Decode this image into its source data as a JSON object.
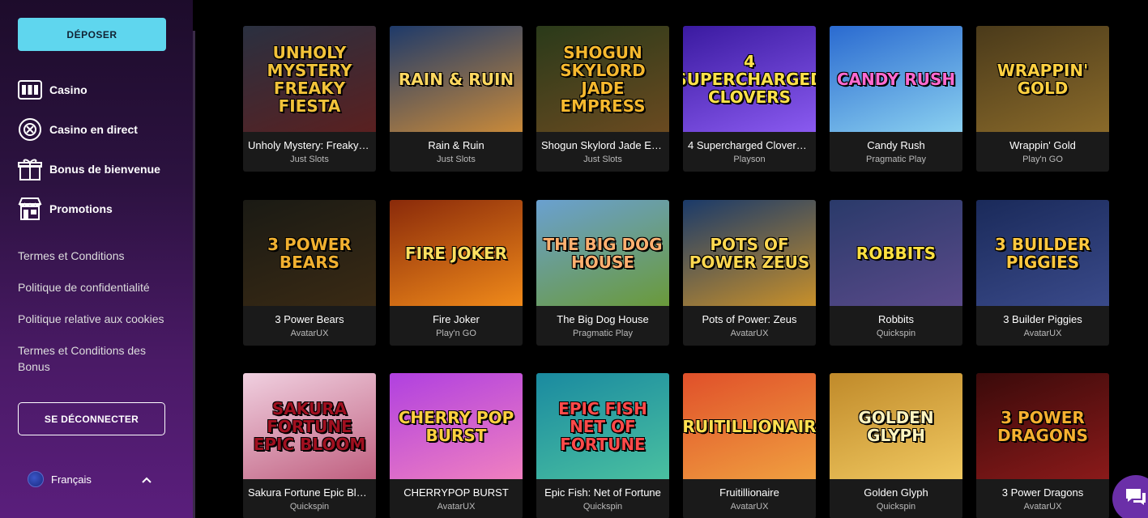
{
  "sidebar": {
    "deposit_label": "DÉPOSER",
    "nav": [
      {
        "label": "Casino",
        "icon": "slot-machine-icon"
      },
      {
        "label": "Casino en direct",
        "icon": "chip-icon"
      },
      {
        "label": "Bonus de bienvenue",
        "icon": "gift-icon"
      },
      {
        "label": "Promotions",
        "icon": "shop-icon"
      }
    ],
    "links": [
      "Termes et Conditions",
      "Politique de confidentialité",
      "Politique relative aux cookies",
      "Termes et Conditions des Bonus"
    ],
    "logout_label": "SE DÉCONNECTER",
    "language": "Français"
  },
  "colors": {
    "accent": "#5fd6ee",
    "sidebar_top": "#1d0c2b",
    "sidebar_bottom": "#5a1e7c",
    "chat": "#6b2fa8"
  },
  "games": [
    {
      "name": "Unholy Mystery: Freaky …",
      "provider": "Just Slots",
      "art": "UNHOLY MYSTERY FREAKY FIESTA",
      "bg": [
        "#2a3040",
        "#5a2020"
      ],
      "fg": "#f2c23a"
    },
    {
      "name": "Rain & Ruin",
      "provider": "Just Slots",
      "art": "RAIN & RUIN",
      "bg": [
        "#1e3a6a",
        "#c98a3a"
      ],
      "fg": "#ffd860"
    },
    {
      "name": "Shogun Skylord Jade Em…",
      "provider": "Just Slots",
      "art": "SHOGUN SKYLORD JADE EMPRESS",
      "bg": [
        "#2a3a1a",
        "#6a4a20"
      ],
      "fg": "#f5b82e"
    },
    {
      "name": "4 Supercharged Clovers:…",
      "provider": "Playson",
      "art": "4 SUPERCHARGED CLOVERS",
      "bg": [
        "#3a1aa0",
        "#8a5af0"
      ],
      "fg": "#ffe24a"
    },
    {
      "name": "Candy Rush",
      "provider": "Pragmatic Play",
      "art": "CANDY RUSH",
      "bg": [
        "#2a6ad0",
        "#8ad0f0"
      ],
      "fg": "#ff6ad0"
    },
    {
      "name": "Wrappin' Gold",
      "provider": "Play'n GO",
      "art": "WRAPPIN' GOLD",
      "bg": [
        "#4a3a1a",
        "#8a6a2a"
      ],
      "fg": "#ffd040"
    },
    {
      "name": "3 Power Bears",
      "provider": "AvatarUX",
      "art": "3 POWER BEARS",
      "bg": [
        "#1a1a14",
        "#3a2a14"
      ],
      "fg": "#f0b030"
    },
    {
      "name": "Fire Joker",
      "provider": "Play'n GO",
      "art": "FIRE JOKER",
      "bg": [
        "#8a2a0a",
        "#f08a1a"
      ],
      "fg": "#ffe060"
    },
    {
      "name": "The Big Dog House",
      "provider": "Pragmatic Play",
      "art": "THE BIG DOG HOUSE",
      "bg": [
        "#6aa0d0",
        "#6a9a3a"
      ],
      "fg": "#ffb070"
    },
    {
      "name": "Pots of Power: Zeus",
      "provider": "AvatarUX",
      "art": "POTS OF POWER ZEUS",
      "bg": [
        "#1a3a6a",
        "#c8902a"
      ],
      "fg": "#ffd850"
    },
    {
      "name": "Robbits",
      "provider": "Quickspin",
      "art": "ROBBITS",
      "bg": [
        "#2a3a6a",
        "#5a4a8a"
      ],
      "fg": "#ffe040"
    },
    {
      "name": "3 Builder Piggies",
      "provider": "AvatarUX",
      "art": "3 BUILDER PIGGIES",
      "bg": [
        "#1a2a5a",
        "#3a4a8a"
      ],
      "fg": "#ffc840"
    },
    {
      "name": "Sakura Fortune Epic Blo…",
      "provider": "Quickspin",
      "art": "SAKURA FORTUNE EPIC BLOOM",
      "bg": [
        "#f0d0e0",
        "#c06080"
      ],
      "fg": "#a01020"
    },
    {
      "name": "CHERRYPOP BURST",
      "provider": "AvatarUX",
      "art": "CHERRY POP BURST",
      "bg": [
        "#b040e0",
        "#f080c0"
      ],
      "fg": "#ffd040"
    },
    {
      "name": "Epic Fish: Net of Fortune",
      "provider": "Quickspin",
      "art": "EPIC FISH NET OF FORTUNE",
      "bg": [
        "#1a8aa0",
        "#4ac0a0"
      ],
      "fg": "#ff4a4a"
    },
    {
      "name": "Fruitillionaire",
      "provider": "AvatarUX",
      "art": "FRUITILLIONAIRE",
      "bg": [
        "#e0502a",
        "#f0a040"
      ],
      "fg": "#ffe050"
    },
    {
      "name": "Golden Glyph",
      "provider": "Quickspin",
      "art": "GOLDEN GLYPH",
      "bg": [
        "#c08a2a",
        "#f0c860"
      ],
      "fg": "#fff4c0"
    },
    {
      "name": "3 Power Dragons",
      "provider": "AvatarUX",
      "art": "3 POWER DRAGONS",
      "bg": [
        "#3a0a0a",
        "#8a1a1a"
      ],
      "fg": "#f5b030"
    }
  ]
}
